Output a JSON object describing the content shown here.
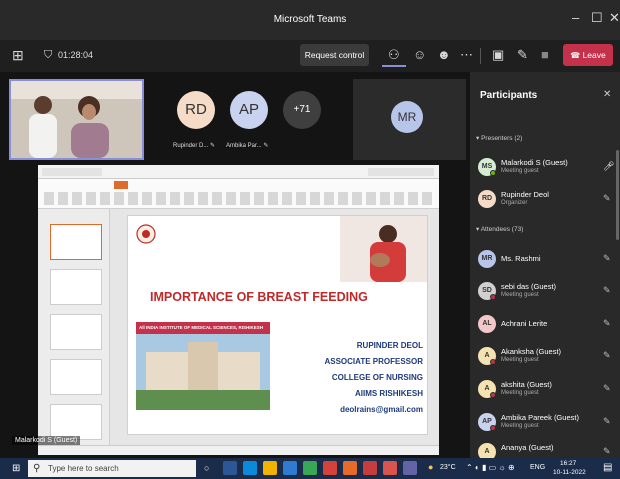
{
  "window": {
    "title": "Microsoft Teams"
  },
  "toolbar": {
    "timer": "01:28:04",
    "request_control": "Request control",
    "leave": "Leave"
  },
  "stage": {
    "video_label": "",
    "avatars": [
      {
        "initials": "RD",
        "name": "Rupinder D...",
        "color": "#f5dcc8"
      },
      {
        "initials": "AP",
        "name": "Ambika Par...",
        "color": "#c9d2ee"
      },
      {
        "initials": "+71",
        "name": "",
        "color": "#3f3f3f"
      },
      {
        "initials": "MR",
        "name": "",
        "color": "#b8c5ea"
      }
    ],
    "presenter_label": "Malarkodi S (Guest)"
  },
  "slide": {
    "title": "IMPORTANCE OF BREAST FEEDING",
    "banner": "All INDIA INSTITUTE OF MEDICAL SCIENCES, RISHIKESH",
    "lines": [
      "RUPINDER DEOL",
      "ASSOCIATE PROFESSOR",
      "COLLEGE OF NURSING",
      "AIIMS RISHIKESH",
      "deolrains@gmail.com"
    ]
  },
  "participants": {
    "title": "Participants",
    "presenters_header": "Presenters (2)",
    "attendees_header": "Attendees (73)",
    "presenters": [
      {
        "initials": "MS",
        "name": "Malarkodi S (Guest)",
        "role": "Meeting guest",
        "color": "#d6ecd2",
        "status": "#6bb700",
        "mic": "on"
      },
      {
        "initials": "RD",
        "name": "Rupinder Deol",
        "role": "Organizer",
        "color": "#f5dcc8",
        "status": "",
        "mic": "off"
      }
    ],
    "attendees": [
      {
        "initials": "MR",
        "name": "Ms. Rashmi",
        "role": "",
        "color": "#b8c5ea",
        "status": "",
        "mic": "off"
      },
      {
        "initials": "SD",
        "name": "sebi das (Guest)",
        "role": "Meeting guest",
        "color": "#d0d0d0",
        "status": "#c4314b",
        "mic": "off"
      },
      {
        "initials": "AL",
        "name": "Achrani Lerite",
        "role": "",
        "color": "#f4c8c8",
        "status": "",
        "mic": "off"
      },
      {
        "initials": "A",
        "name": "Akanksha (Guest)",
        "role": "Meeting guest",
        "color": "#f4e3b0",
        "status": "#c4314b",
        "mic": "off"
      },
      {
        "initials": "A",
        "name": "akshita (Guest)",
        "role": "Meeting guest",
        "color": "#f4e3b0",
        "status": "#c4314b",
        "mic": "off"
      },
      {
        "initials": "AP",
        "name": "Ambika Pareek (Guest)",
        "role": "Meeting guest",
        "color": "#c9d2ee",
        "status": "#c4314b",
        "mic": "off"
      },
      {
        "initials": "A",
        "name": "Ananya (Guest)",
        "role": "",
        "color": "#f4e3b0",
        "status": "",
        "mic": "off"
      }
    ]
  },
  "taskbar": {
    "search": "Type here to search",
    "weather": "23°C",
    "lang": "ENG",
    "time": "16:27",
    "date": "10-11-2022"
  }
}
